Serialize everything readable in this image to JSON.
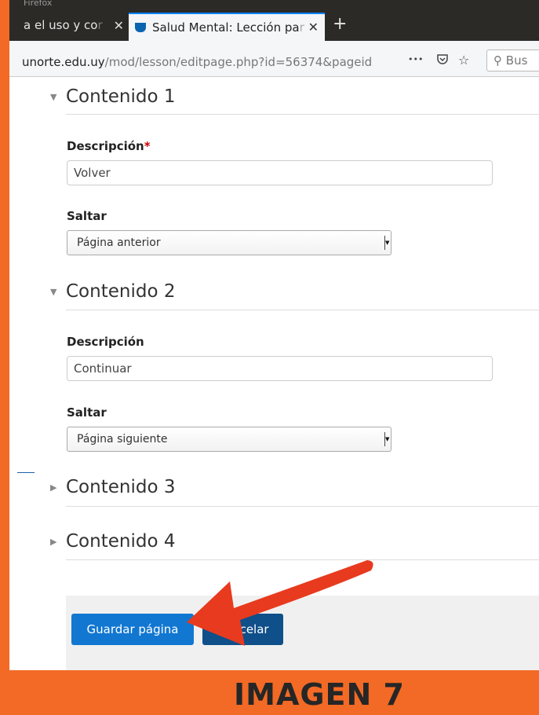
{
  "browser": {
    "title_fragment": "Firefox",
    "tab1_label": "a el uso y co",
    "tab1_fade": "r",
    "tab2_label": "Salud Mental: Lección pa",
    "tab2_fade": "r",
    "url_domain": "unorte.edu.uy",
    "url_path": "/mod/lesson/editpage.php?id=56374&pageid",
    "more_label": "•••",
    "search_placeholder": "Bus"
  },
  "form": {
    "section1": {
      "title": "Contenido 1",
      "desc_label": "Descripción",
      "desc_required": "*",
      "desc_value": "Volver",
      "jump_label": "Saltar",
      "jump_value": "Página anterior"
    },
    "section2": {
      "title": "Contenido 2",
      "desc_label": "Descripción",
      "desc_value": "Continuar",
      "jump_label": "Saltar",
      "jump_value": "Página siguiente"
    },
    "section3": {
      "title": "Contenido 3"
    },
    "section4": {
      "title": "Contenido 4"
    },
    "save_button": "Guardar página",
    "cancel_button": "Cancelar"
  },
  "caption": "IMAGEN 7",
  "colors": {
    "frame_border": "#f26a25",
    "arrow": "#e83a1e",
    "primary_button": "#1177d1",
    "cancel_button": "#0f4f8a"
  }
}
